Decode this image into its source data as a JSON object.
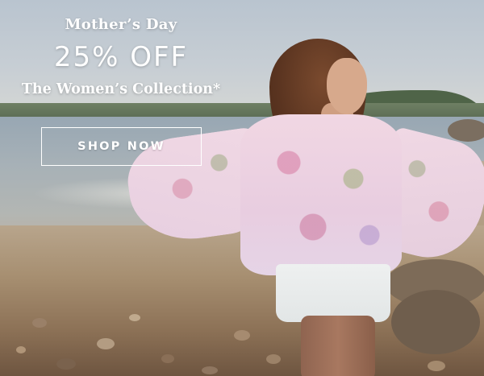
{
  "promo": {
    "occasion": "Mother’s Day",
    "discount": "25% OFF",
    "collection": "The Women’s Collection*",
    "cta_label": "SHOP NOW"
  },
  "photo": {
    "subject": "woman in floral sheer blouse and white shorts on a pebbly beach"
  },
  "colors": {
    "text": "#ffffff",
    "button_border": "#ffffff"
  }
}
